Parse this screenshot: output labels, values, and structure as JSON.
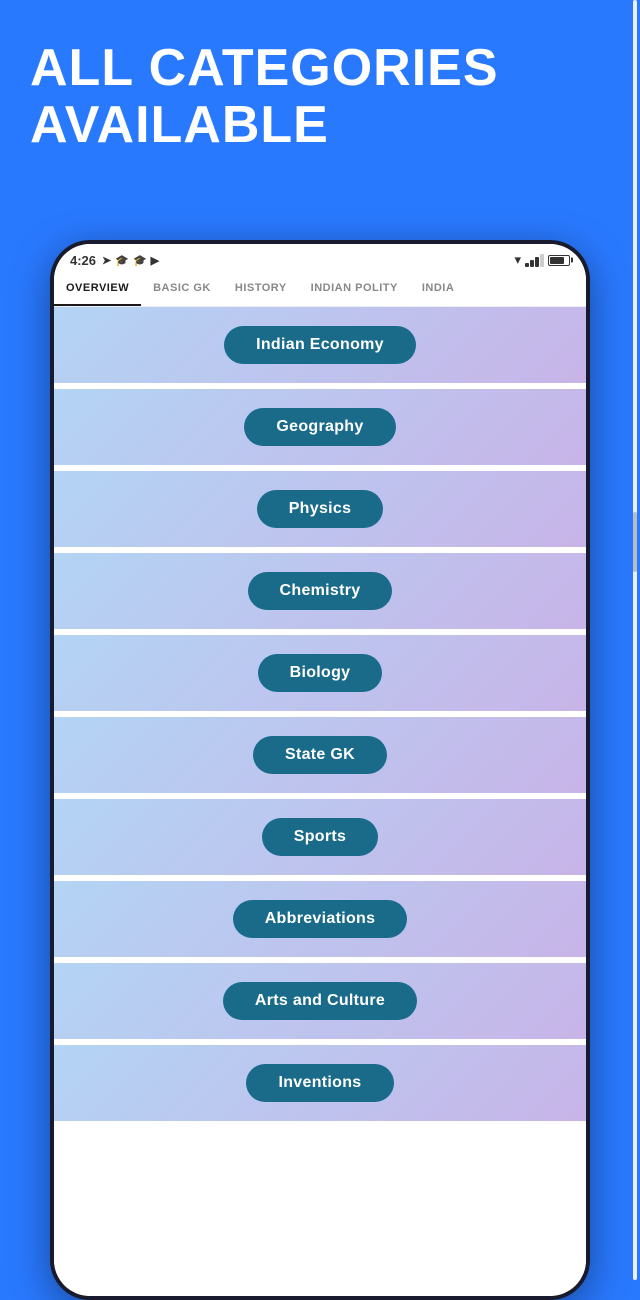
{
  "header": {
    "title_line1": "ALL CATEGORIES",
    "title_line2": "AVAILABLE"
  },
  "status_bar": {
    "time": "4:26",
    "battery_percent": 80
  },
  "tabs": [
    {
      "label": "OVERVIEW",
      "active": true
    },
    {
      "label": "BASIC GK",
      "active": false
    },
    {
      "label": "HISTORY",
      "active": false
    },
    {
      "label": "INDIAN POLITY",
      "active": false
    },
    {
      "label": "INDIA",
      "active": false
    }
  ],
  "categories": [
    {
      "label": "Indian Economy"
    },
    {
      "label": "Geography"
    },
    {
      "label": "Physics"
    },
    {
      "label": "Chemistry"
    },
    {
      "label": "Biology"
    },
    {
      "label": "State GK"
    },
    {
      "label": "Sports"
    },
    {
      "label": "Abbreviations"
    },
    {
      "label": "Arts and Culture"
    },
    {
      "label": "Inventions"
    }
  ]
}
